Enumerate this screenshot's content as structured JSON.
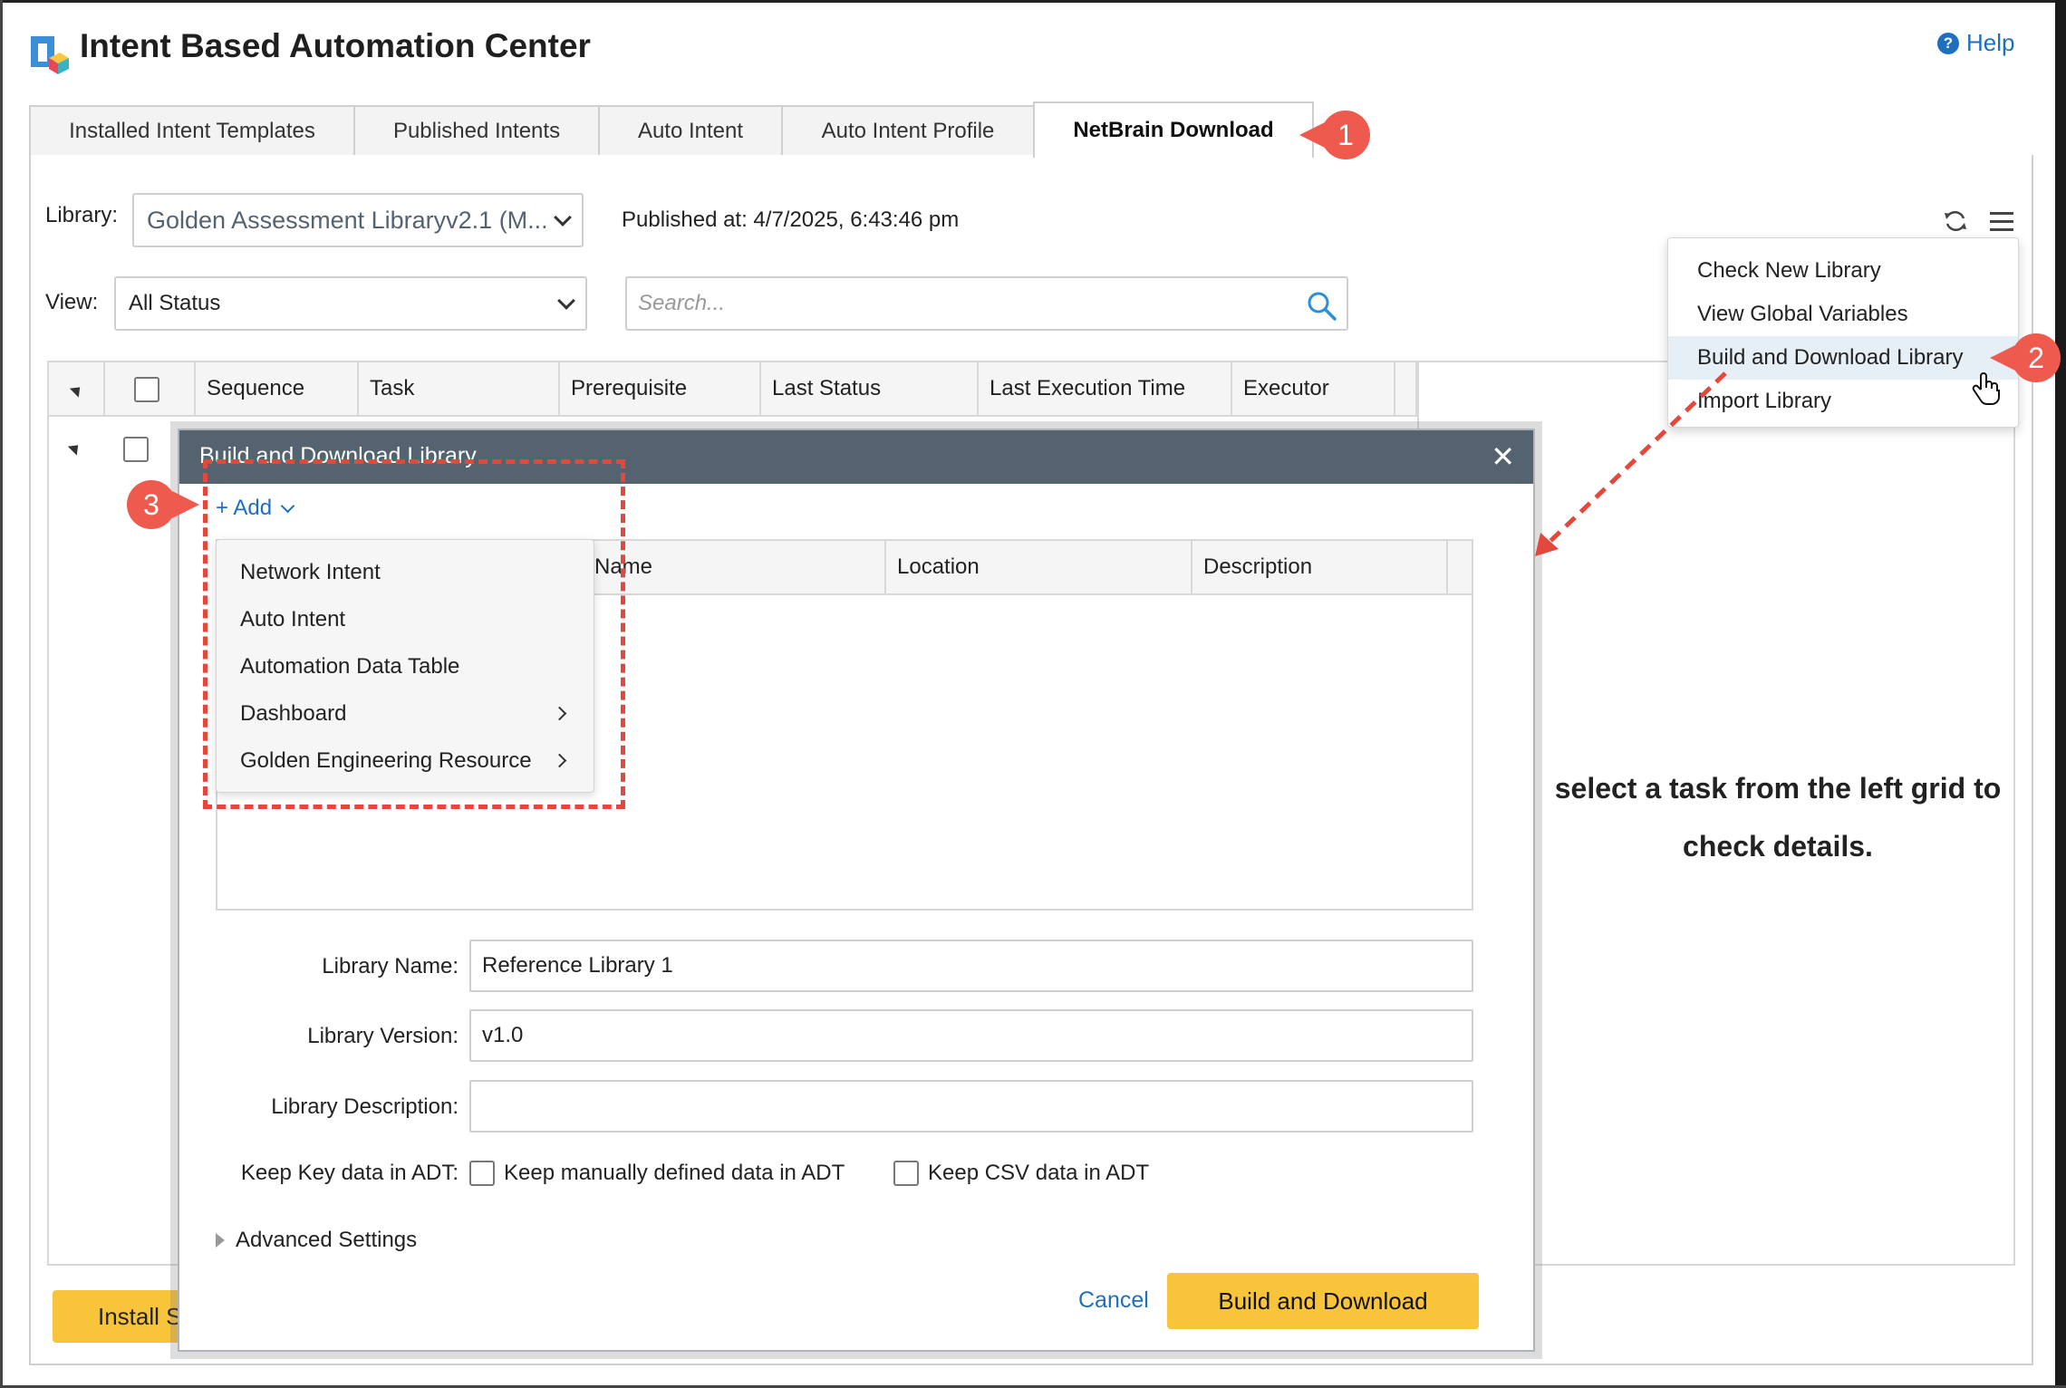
{
  "app": {
    "title": "Intent Based Automation Center",
    "help_label": "Help"
  },
  "tabs": [
    {
      "label": "Installed Intent Templates"
    },
    {
      "label": "Published Intents"
    },
    {
      "label": "Auto Intent"
    },
    {
      "label": "Auto Intent Profile"
    },
    {
      "label": "NetBrain Download",
      "active": true
    }
  ],
  "filters": {
    "library_label": "Library:",
    "library_value": "Golden Assessment Libraryv2.1 (M...",
    "published_at": "Published at: 4/7/2025, 6:43:46 pm",
    "view_label": "View:",
    "view_value": "All Status",
    "search_placeholder": "Search..."
  },
  "grid": {
    "columns": [
      "Sequence",
      "Task",
      "Prerequisite",
      "Last Status",
      "Last Execution Time",
      "Executor"
    ],
    "detail_message": "select a task from the left grid to check details."
  },
  "footer": {
    "install_label": "Install S"
  },
  "context_menu": {
    "items": [
      {
        "label": "Check New Library"
      },
      {
        "label": "View Global Variables"
      },
      {
        "label": "Build and Download Library",
        "highlighted": true
      },
      {
        "label": "Import Library"
      }
    ]
  },
  "dialog": {
    "title": "Build and Download Library",
    "add_label": "+ Add",
    "columns": [
      "Name",
      "Location",
      "Description"
    ],
    "add_menu": [
      {
        "label": "Network Intent",
        "submenu": false
      },
      {
        "label": "Auto Intent",
        "submenu": false
      },
      {
        "label": "Automation Data Table",
        "submenu": false
      },
      {
        "label": "Dashboard",
        "submenu": true
      },
      {
        "label": "Golden Engineering Resource",
        "submenu": true
      }
    ],
    "form": {
      "name_label": "Library Name:",
      "name_value": "Reference Library 1",
      "version_label": "Library Version:",
      "version_value": "v1.0",
      "description_label": "Library Description:",
      "description_value": "",
      "keep_key_label": "Keep Key data in ADT:",
      "keep_manual_label": "Keep manually defined data in ADT",
      "keep_csv_label": "Keep CSV data in ADT"
    },
    "advanced_label": "Advanced Settings",
    "cancel_label": "Cancel",
    "build_label": "Build and Download"
  },
  "callouts": {
    "one": "1",
    "two": "2",
    "three": "3"
  },
  "colors": {
    "accent": "#f8c53a",
    "link": "#1e6fbf",
    "callout": "#ef5a4f",
    "dialog_header": "#556371"
  }
}
